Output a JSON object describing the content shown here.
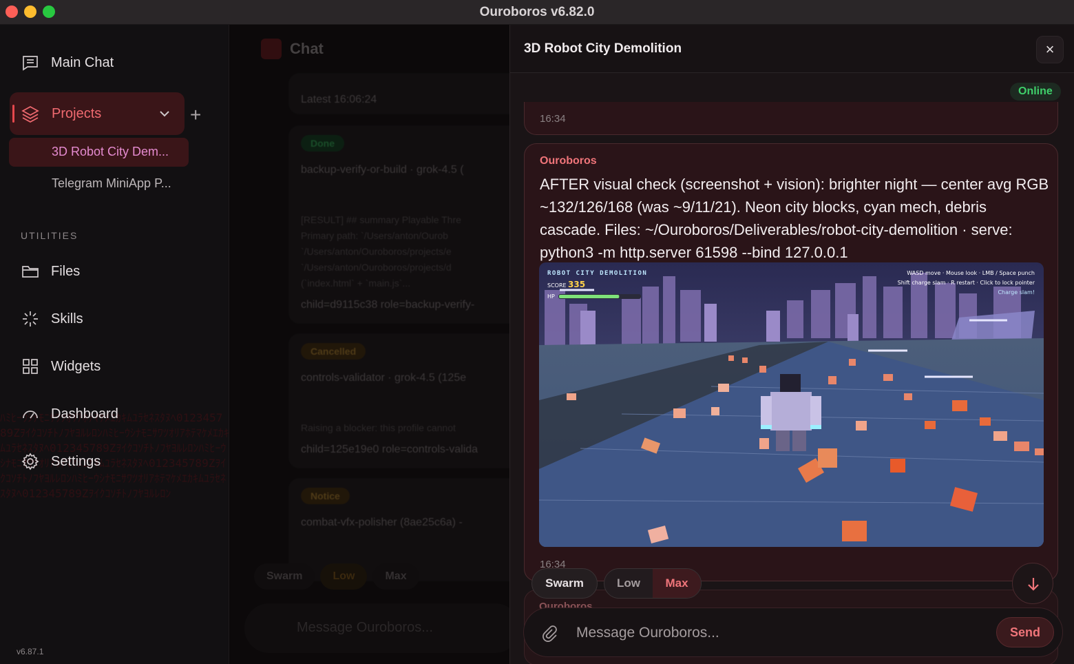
{
  "window": {
    "title": "Ouroboros v6.82.0"
  },
  "sidebar": {
    "main_chat": "Main Chat",
    "projects_label": "Projects",
    "projects": [
      {
        "label": "3D Robot City Dem..."
      },
      {
        "label": "Telegram MiniApp P..."
      }
    ],
    "utilities_heading": "UTILITIES",
    "utilities": [
      {
        "label": "Files",
        "icon": "folder-icon"
      },
      {
        "label": "Skills",
        "icon": "sparkle-icon"
      },
      {
        "label": "Widgets",
        "icon": "grid-icon"
      },
      {
        "label": "Dashboard",
        "icon": "gauge-icon"
      },
      {
        "label": "Settings",
        "icon": "gear-icon"
      }
    ],
    "version": "v6.87.1"
  },
  "chat": {
    "title": "Chat",
    "latest": "Latest 16:06:24",
    "cards": [
      {
        "status": "Done",
        "line": "backup-verify-or-build · grok-4.5 (",
        "detail": [
          "[RESULT] ## summary Playable Thre",
          "Primary path: `/Users/anton/Ourob",
          "`/Users/anton/Ouroboros/projects/e",
          "`/Users/anton/Ouroboros/projects/d",
          "(`index.html` + `main.js`..."
        ],
        "child": "child=d9115c38 role=backup-verify-"
      },
      {
        "status": "Cancelled",
        "line": "controls-validator · grok-4.5 (125e",
        "detail": [
          "Raising a blocker: this profile cannot"
        ],
        "child": "child=125e19e0 role=controls-valida"
      },
      {
        "status": "Notice",
        "line": "combat-vfx-polisher (8ae25c6a) -",
        "detail": [],
        "child": ""
      }
    ],
    "modes": [
      "Swarm",
      "Low",
      "Max"
    ],
    "placeholder": "Message Ouroboros...",
    "footer": "3D Robot City Demolition"
  },
  "panel": {
    "title": "3D Robot City Demolition",
    "status": "Online",
    "prev_time": "16:34",
    "message": {
      "author": "Ouroboros",
      "text": "AFTER visual check (screenshot + vision): brighter night — center avg RGB ~132/126/168 (was ~9/11/21). Neon city blocks, cyan mech, debris cascade. Files: ~/Ouroboros/Deliverables/robot-city-demolition · serve: python3 -m http.server 61598 --bind 127.0.0.1",
      "time": "16:34",
      "screenshot": {
        "game_title": "ROBOT CITY DEMOLITION",
        "score_label": "SCORE",
        "score": "335",
        "hp_label": "HP",
        "hp_fraction": 0.74,
        "help_line1": "WASD move · Mouse look · LMB / Space punch",
        "help_line2": "Shift charge slam · R restart · Click to lock pointer",
        "help_line3": "Charge slam!"
      }
    },
    "next_author": "Ouroboros",
    "modes": {
      "swarm": "Swarm",
      "low": "Low",
      "max": "Max",
      "selected": "Max"
    },
    "composer": {
      "placeholder": "Message Ouroboros...",
      "send": "Send"
    },
    "colors": {
      "accent": "#f0757a",
      "online": "#3fcf6a"
    }
  }
}
